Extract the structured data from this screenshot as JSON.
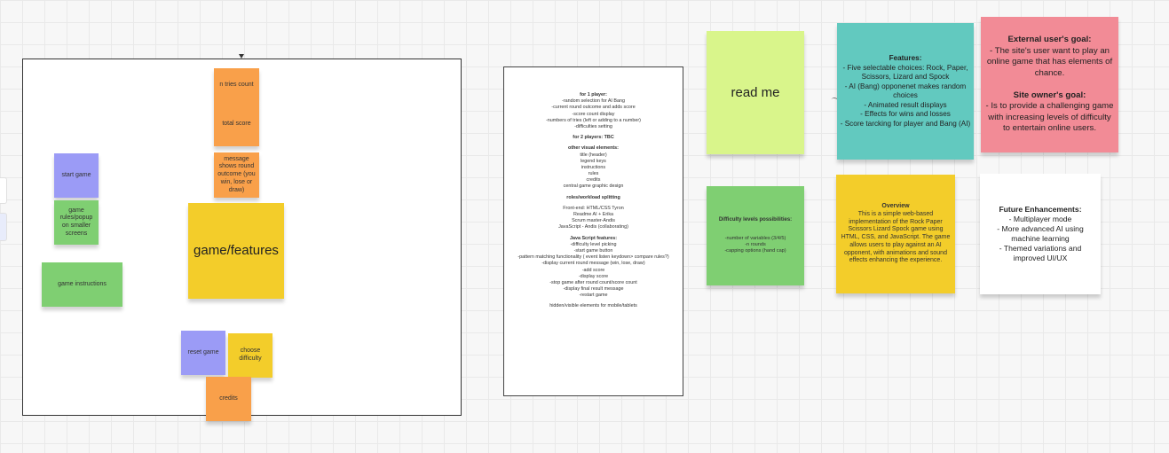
{
  "board": {
    "wireframe": {
      "notes": {
        "tries_count": "n tries count",
        "total_score": "total score",
        "message": "message shows round outcome (you win, lose or draw)",
        "start_game": "start game",
        "game_rules": "game rules/popup on smaller screens",
        "game_instructions": "game instructions",
        "game_features": "game/features",
        "reset_game": "reset game",
        "choose_difficulty": "choose difficulty",
        "credits": "credits"
      }
    },
    "plan_doc": {
      "sections": [
        {
          "heading": "for 1 player:",
          "lines": [
            "-random selection for AI Bang",
            "-current round outcome and adds score",
            "-score count display",
            "-numbers of tries (left or adding to a number)",
            "-difficulties setting"
          ]
        },
        {
          "heading": "for 2 players: TBC",
          "lines": []
        },
        {
          "heading": "other visual elements:",
          "lines": [
            "title (header)",
            "legend keys",
            "instructions",
            "rules",
            "credits",
            "central game graphic design"
          ]
        },
        {
          "heading": "roles/workload splitting",
          "lines": [
            "",
            "Front-end: HTML/CSS Tyron",
            "Readme AI + Erika",
            "Scrum master-Andis",
            "JavaScript - Andis (collaborating)"
          ]
        },
        {
          "heading": "Java Script features:",
          "lines": [
            "-difficulty level picking",
            "-start game button",
            "-pattern matching functionality ( event listen keydown> compare rules?)",
            "-display current round message (win, lose, draw)",
            "-add score",
            "-display score",
            "-stop game after round count/score count",
            "-display final result message",
            "-restart game",
            "",
            "hidden/visible elements for mobile/tablets"
          ]
        }
      ]
    },
    "notes": {
      "read_me": "read me",
      "features": {
        "title": "Features:",
        "body": "- Five selectable choices: Rock, Paper, Scissors, Lizard and Spock\n- AI (Bang) opponenet makes random choices\n- Animated result displays\n- Effects for wins and losses\n- Score tarcking for player and Bang (AI)"
      },
      "goals": {
        "external_title": "External user's goal:",
        "external_body": "- The site's user want to play an online game that has elements of chance.",
        "owner_title": "Site owner's goal:",
        "owner_body": "- Is to provide a challenging game with increasing levels of difficulty to entertain online users."
      },
      "difficulty": {
        "title": "Difficulty levels possibilities:",
        "body": "-number of variables (3/4/5)\n-n rounds\n-capping options (hand cap)"
      },
      "overview": {
        "title": "Overview",
        "body": "This is a simple web-based implementation of the Rock Paper Scissors Lizard Spock game using HTML, CSS, and JavaScript. The game allows users to play against an AI opponent, with animations and sound effects enhancing the experience."
      },
      "future": {
        "title": "Future Enhancements:",
        "body": "- Multiplayer mode\n- More advanced AI using machine learning\n- Themed variations and improved UI/UX"
      }
    }
  }
}
